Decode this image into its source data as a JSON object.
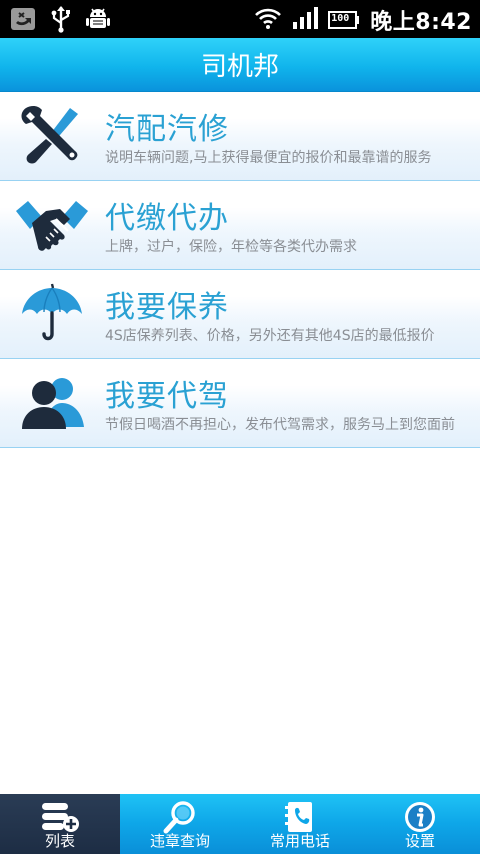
{
  "status_bar": {
    "time": "晚上8:42",
    "battery_label": "100",
    "icons": [
      "missed-call-icon",
      "usb-icon",
      "android-debug-icon",
      "wifi-icon",
      "signal-icon",
      "battery-icon"
    ]
  },
  "header": {
    "title": "司机邦"
  },
  "list": {
    "items": [
      {
        "title": "汽配汽修",
        "description": "说明车辆问题,马上获得最便宜的报价和最靠谱的服务",
        "icon": "tools-icon"
      },
      {
        "title": "代缴代办",
        "description": "上牌，过户，保险，年检等各类代办需求",
        "icon": "handshake-icon"
      },
      {
        "title": "我要保养",
        "description": "4S店保养列表、价格，另外还有其他4S店的最低报价",
        "icon": "umbrella-icon"
      },
      {
        "title": "我要代驾",
        "description": "节假日喝酒不再担心，发布代驾需求，服务马上到您面前",
        "icon": "users-icon"
      }
    ]
  },
  "tab_bar": {
    "tabs": [
      {
        "label": "列表",
        "icon": "list-add-icon",
        "active": true
      },
      {
        "label": "违章查询",
        "icon": "magnifier-icon",
        "active": false
      },
      {
        "label": "常用电话",
        "icon": "phonebook-icon",
        "active": false
      },
      {
        "label": "设置",
        "icon": "info-icon",
        "active": false
      }
    ]
  },
  "colors": {
    "accent": "#2aa1d3",
    "header_blue": "#10b4ec",
    "active_tab": "#1d2d44",
    "icon_dark": "#1e2b3c",
    "icon_blue": "#2a9ad8"
  }
}
